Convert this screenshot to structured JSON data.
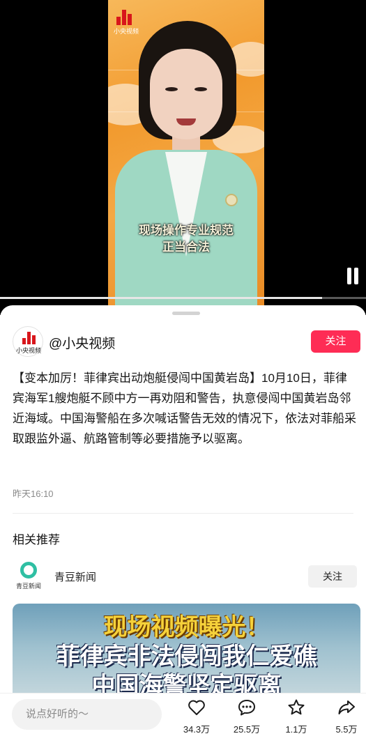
{
  "video": {
    "channel_logo_text": "小央视频",
    "subtitle_line1": "现场操作专业规范",
    "subtitle_line2": "正当合法",
    "progress": 0.88
  },
  "post": {
    "author_avatar_text": "小央视频",
    "author_name": "@小央视频",
    "follow_label": "关注",
    "description": "【变本加厉！菲律宾出动炮艇侵闯中国黄岩岛】10月10日，菲律宾海军1艘炮艇不顾中方一再劝阻和警告，执意侵闯中国黄岩岛邻近海域。中国海警船在多次喊话警告无效的情况下，依法对菲船采取跟监外逼、航路管制等必要措施予以驱离。",
    "time": "昨天16:10"
  },
  "related": {
    "title": "相关推荐",
    "author_avatar_text": "青豆新闻",
    "author_name": "青豆新闻",
    "follow_label": "关注",
    "thumb_line1": "现场视频曝光！",
    "thumb_line2": "菲律宾非法侵闯我仁爱礁",
    "thumb_line3": "中国海警坚定驱离"
  },
  "bottom": {
    "comment_placeholder": "说点好听的～",
    "like_count": "34.3万",
    "comment_count": "25.5万",
    "favorite_count": "1.1万",
    "share_count": "5.5万"
  },
  "colors": {
    "accent": "#fe2c55",
    "logo_red": "#d8161b"
  }
}
